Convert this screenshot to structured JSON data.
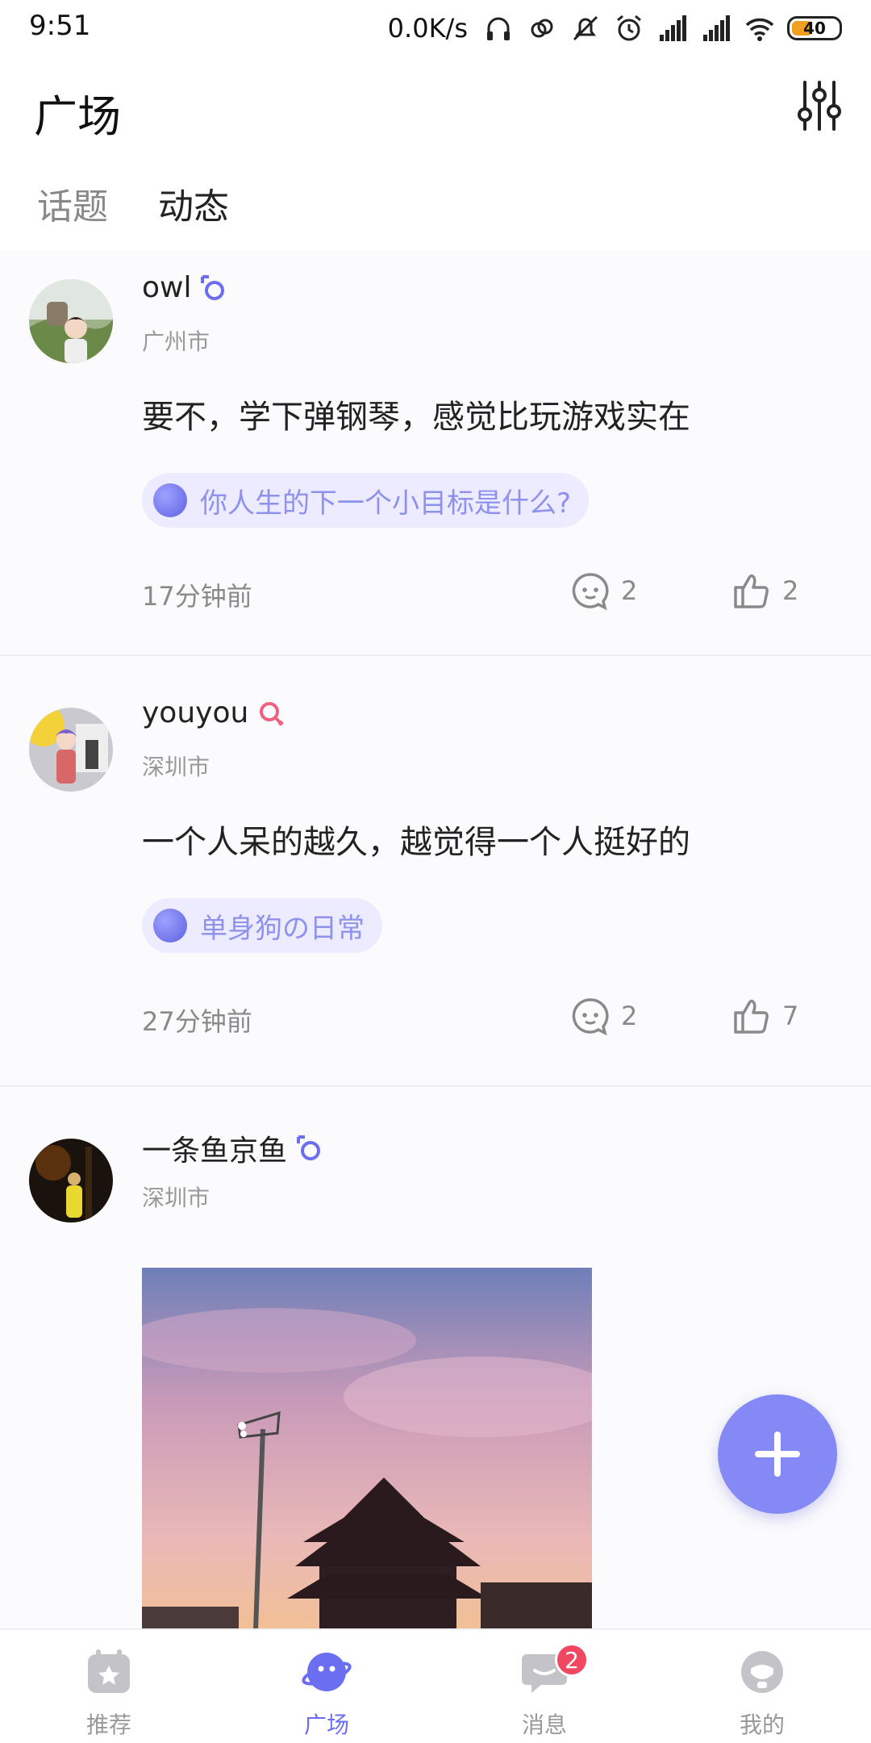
{
  "status_bar": {
    "time": "9:51",
    "net_speed": "0.0K/s",
    "battery": "40",
    "icons": [
      "headphones-icon",
      "link-icon",
      "mute-icon",
      "alarm-icon",
      "signal-icon",
      "signal-icon",
      "wifi-icon",
      "battery-icon"
    ]
  },
  "header": {
    "title": "广场",
    "filter_icon": "sliders-icon",
    "tabs": [
      {
        "label": "话题",
        "active": false
      },
      {
        "label": "动态",
        "active": true
      }
    ]
  },
  "posts": [
    {
      "username": "owl",
      "gender": "male",
      "city": "广州市",
      "content": "要不，学下弹钢琴，感觉比玩游戏实在",
      "topic": "你人生的下一个小目标是什么?",
      "time": "17分钟前",
      "comments": "2",
      "likes": "2"
    },
    {
      "username": "youyou",
      "gender": "female",
      "city": "深圳市",
      "content": "一个人呆的越久，越觉得一个人挺好的",
      "topic": "单身狗の日常",
      "time": "27分钟前",
      "comments": "2",
      "likes": "7"
    },
    {
      "username": "一条鱼京鱼",
      "gender": "male",
      "city": "深圳市"
    }
  ],
  "fab_icon": "plus-icon",
  "bottom_nav": [
    {
      "label": "推荐",
      "icon": "calendar-star-icon",
      "active": false
    },
    {
      "label": "广场",
      "icon": "planet-icon",
      "active": true
    },
    {
      "label": "消息",
      "icon": "chat-icon",
      "active": false,
      "badge": "2"
    },
    {
      "label": "我的",
      "icon": "profile-icon",
      "active": false
    }
  ],
  "colors": {
    "accent": "#6b6ef0",
    "fab": "#8589f5",
    "chip_bg": "#ecebff",
    "badge": "#f04860"
  }
}
